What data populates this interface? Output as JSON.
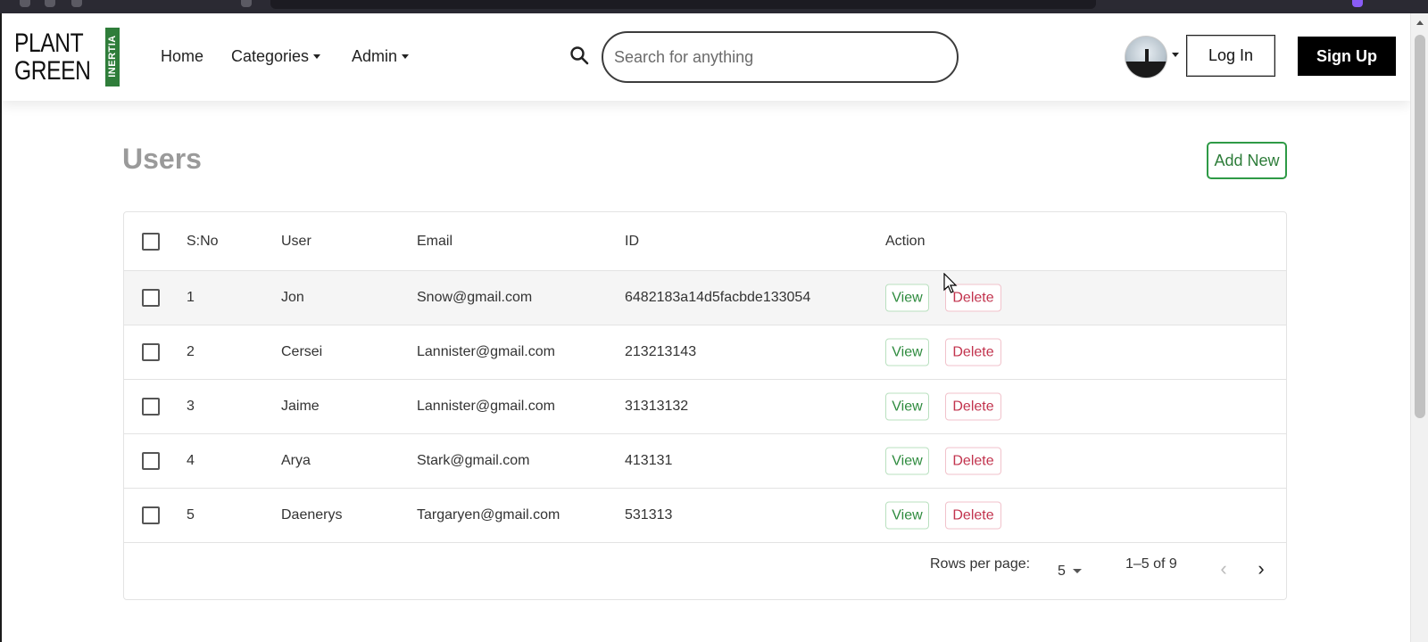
{
  "header": {
    "logo_line1": "PLANT",
    "logo_line2": "GREEN",
    "logo_side": "INERTIA",
    "nav": {
      "home": "Home",
      "categories": "Categories",
      "admin": "Admin"
    },
    "search_placeholder": "Search for anything",
    "login_label": "Log In",
    "signup_label": "Sign Up"
  },
  "page": {
    "title": "Users",
    "add_new_label": "Add New"
  },
  "table": {
    "columns": {
      "sno": "S:No",
      "user": "User",
      "email": "Email",
      "id": "ID",
      "action": "Action"
    },
    "rows": [
      {
        "sno": "1",
        "user": "Jon",
        "email": "Snow@gmail.com",
        "id": "6482183a14d5facbde133054"
      },
      {
        "sno": "2",
        "user": "Cersei",
        "email": "Lannister@gmail.com",
        "id": "213213143"
      },
      {
        "sno": "3",
        "user": "Jaime",
        "email": "Lannister@gmail.com",
        "id": "31313132"
      },
      {
        "sno": "4",
        "user": "Arya",
        "email": "Stark@gmail.com",
        "id": "413131"
      },
      {
        "sno": "5",
        "user": "Daenerys",
        "email": "Targaryen@gmail.com",
        "id": "531313"
      }
    ],
    "view_label": "View",
    "delete_label": "Delete"
  },
  "pagination": {
    "rows_per_page_label": "Rows per page:",
    "rows_per_page_value": "5",
    "range_text": "1–5 of 9",
    "prev_icon": "chevron-left-icon",
    "next_icon": "chevron-right-icon"
  },
  "colors": {
    "brand_green": "#2f7d3a",
    "view_green": "#2e8b3e",
    "delete_red": "#c2334d",
    "signup_bg": "#000000"
  }
}
